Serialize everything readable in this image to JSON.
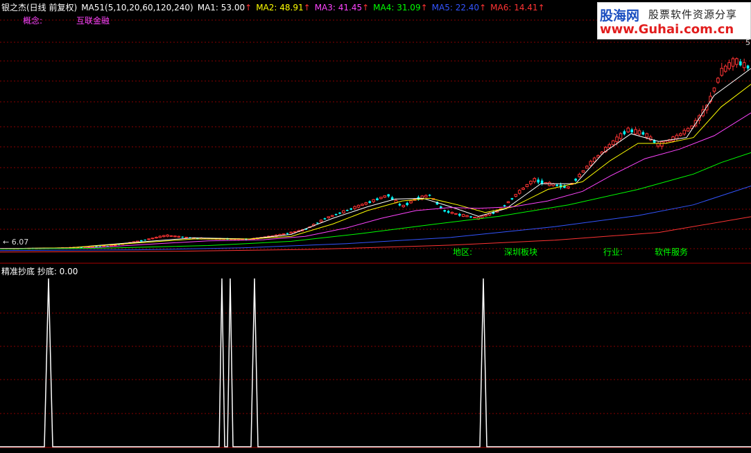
{
  "header": {
    "stock": "银之杰(日线 前复权)",
    "indicator": "MA51(5,10,20,60,120,240)",
    "mas": [
      {
        "label": "MA1: 53.00",
        "color": "#ffffff"
      },
      {
        "label": "MA2: 48.91",
        "color": "#ffff00"
      },
      {
        "label": "MA3: 41.45",
        "color": "#ff44ff"
      },
      {
        "label": "MA4: 31.09",
        "color": "#00ff00"
      },
      {
        "label": "MA5: 22.40",
        "color": "#3355ff"
      },
      {
        "label": "MA6: 14.41",
        "color": "#ff3333"
      }
    ],
    "arrow": "↑"
  },
  "concept": {
    "label": "概念:",
    "value": "互联金融"
  },
  "info": {
    "region_label": "地区:",
    "region_value": "深圳板块",
    "industry_label": "行业:",
    "industry_value": "软件服务"
  },
  "price_labels": {
    "low": "6.07",
    "high_partial": "5"
  },
  "lower_title": "精准抄底  抄底: 0.00",
  "watermark": {
    "brand": "股海网",
    "tagline": "股票软件资源分享",
    "url": "www.Guhai.com.cn"
  },
  "colors": {
    "grid": "#8a0000",
    "up": "#ff3333",
    "down": "#00ffff",
    "ma1": "#ffffff",
    "ma2": "#ffff00",
    "ma3": "#ff44ff",
    "ma4": "#00ff00",
    "ma5": "#3355ff",
    "ma6": "#ff3333",
    "signal": "#ffffff",
    "concept_label": "#ff44ff",
    "info_text": "#00ff00"
  },
  "chart_data": [
    {
      "type": "candlestick",
      "ylim": [
        5,
        60
      ],
      "price_points": [
        [
          0,
          6.07
        ],
        [
          40,
          6.1
        ],
        [
          80,
          6.2
        ],
        [
          120,
          6.4
        ],
        [
          160,
          6.8
        ],
        [
          200,
          8
        ],
        [
          240,
          9.5
        ],
        [
          280,
          8.8
        ],
        [
          320,
          8.6
        ],
        [
          360,
          8.5
        ],
        [
          400,
          9.5
        ],
        [
          440,
          11
        ],
        [
          470,
          14
        ],
        [
          500,
          16
        ],
        [
          530,
          18
        ],
        [
          560,
          20
        ],
        [
          580,
          17
        ],
        [
          600,
          19
        ],
        [
          620,
          20
        ],
        [
          640,
          16
        ],
        [
          660,
          15
        ],
        [
          690,
          14
        ],
        [
          720,
          16
        ],
        [
          750,
          21
        ],
        [
          770,
          24
        ],
        [
          790,
          23
        ],
        [
          820,
          22
        ],
        [
          850,
          28
        ],
        [
          880,
          33
        ],
        [
          905,
          37
        ],
        [
          930,
          36
        ],
        [
          950,
          33
        ],
        [
          975,
          35
        ],
        [
          1000,
          38
        ],
        [
          1020,
          43
        ],
        [
          1040,
          52
        ],
        [
          1060,
          55
        ],
        [
          1083,
          53
        ]
      ],
      "ma_lines": [
        {
          "name": "MA1",
          "points": [
            [
              0,
              6.1
            ],
            [
              100,
              6.3
            ],
            [
              200,
              7.8
            ],
            [
              280,
              8.9
            ],
            [
              360,
              8.6
            ],
            [
              420,
              9.8
            ],
            [
              480,
              14
            ],
            [
              530,
              17
            ],
            [
              570,
              19
            ],
            [
              610,
              19.2
            ],
            [
              650,
              17
            ],
            [
              690,
              14.5
            ],
            [
              730,
              16.5
            ],
            [
              780,
              23
            ],
            [
              830,
              23
            ],
            [
              870,
              31
            ],
            [
              910,
              36
            ],
            [
              950,
              34
            ],
            [
              990,
              35
            ],
            [
              1030,
              46
            ],
            [
              1083,
              53
            ]
          ]
        },
        {
          "name": "MA2",
          "points": [
            [
              0,
              6.1
            ],
            [
              100,
              6.3
            ],
            [
              200,
              7.6
            ],
            [
              280,
              8.6
            ],
            [
              360,
              8.6
            ],
            [
              420,
              9.3
            ],
            [
              480,
              12.5
            ],
            [
              530,
              16
            ],
            [
              580,
              18.5
            ],
            [
              620,
              19.2
            ],
            [
              660,
              17.5
            ],
            [
              700,
              15.5
            ],
            [
              740,
              17
            ],
            [
              790,
              21.5
            ],
            [
              840,
              23.5
            ],
            [
              880,
              29
            ],
            [
              920,
              33.5
            ],
            [
              960,
              33.5
            ],
            [
              1000,
              35
            ],
            [
              1040,
              43
            ],
            [
              1083,
              48.9
            ]
          ]
        },
        {
          "name": "MA3",
          "points": [
            [
              0,
              6.1
            ],
            [
              120,
              6.2
            ],
            [
              220,
              7.3
            ],
            [
              300,
              8.1
            ],
            [
              380,
              8.4
            ],
            [
              440,
              9.3
            ],
            [
              500,
              11.5
            ],
            [
              550,
              14
            ],
            [
              600,
              16
            ],
            [
              650,
              16.8
            ],
            [
              690,
              16.6
            ],
            [
              740,
              17
            ],
            [
              790,
              18.5
            ],
            [
              840,
              21
            ],
            [
              880,
              25
            ],
            [
              930,
              29.5
            ],
            [
              980,
              32
            ],
            [
              1030,
              35.5
            ],
            [
              1083,
              41.45
            ]
          ]
        },
        {
          "name": "MA4",
          "points": [
            [
              0,
              6.0
            ],
            [
              150,
              6.2
            ],
            [
              300,
              6.9
            ],
            [
              420,
              8.0
            ],
            [
              520,
              10
            ],
            [
              620,
              12.3
            ],
            [
              720,
              14.5
            ],
            [
              820,
              17.5
            ],
            [
              920,
              21.5
            ],
            [
              1000,
              25.5
            ],
            [
              1040,
              28.5
            ],
            [
              1083,
              31.1
            ]
          ]
        },
        {
          "name": "MA5",
          "points": [
            [
              0,
              5.6
            ],
            [
              200,
              5.8
            ],
            [
              350,
              6.3
            ],
            [
              500,
              7.4
            ],
            [
              650,
              9.0
            ],
            [
              800,
              11.8
            ],
            [
              920,
              14.7
            ],
            [
              1000,
              17.5
            ],
            [
              1083,
              22.4
            ]
          ]
        },
        {
          "name": "MA6",
          "points": [
            [
              0,
              5.2
            ],
            [
              250,
              5.4
            ],
            [
              450,
              5.9
            ],
            [
              650,
              7.0
            ],
            [
              800,
              8.3
            ],
            [
              950,
              10.3
            ],
            [
              1083,
              14.4
            ]
          ]
        }
      ]
    },
    {
      "type": "line",
      "ylim": [
        0,
        1
      ],
      "x": [
        0,
        64,
        70,
        76,
        316,
        320,
        324,
        328,
        332,
        336,
        362,
        367,
        372,
        692,
        697,
        702,
        1083
      ],
      "values": [
        0,
        0,
        1,
        0,
        0,
        1,
        0,
        0,
        1,
        0,
        0,
        1,
        0,
        0,
        1,
        0,
        0
      ]
    }
  ]
}
